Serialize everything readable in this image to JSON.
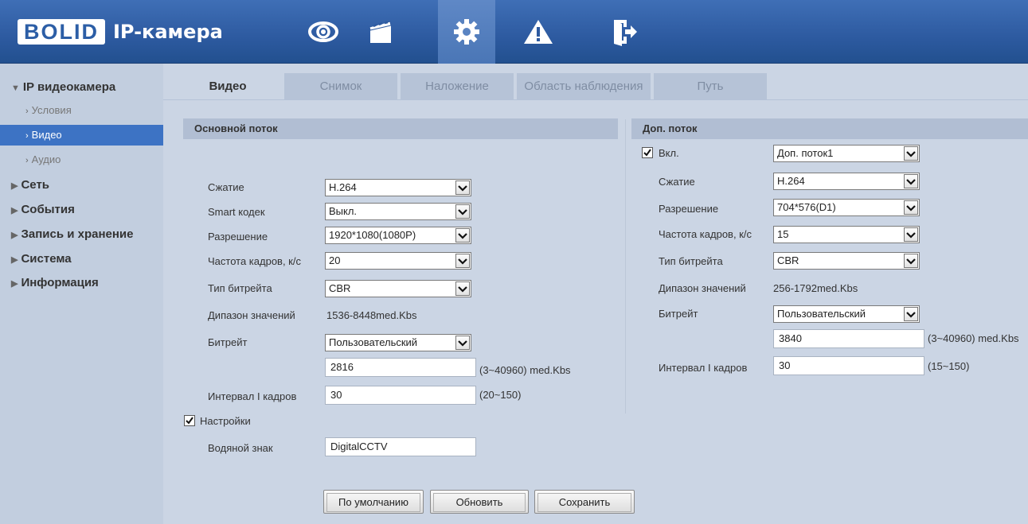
{
  "app": {
    "logo": "BOLID",
    "title": "IP-камера"
  },
  "topnav": [
    {
      "icon": "eye-icon"
    },
    {
      "icon": "clapperboard-icon"
    },
    {
      "icon": "gear-icon"
    },
    {
      "icon": "warning-icon"
    },
    {
      "icon": "logout-icon"
    }
  ],
  "sidebar": {
    "ipcam": "IP видеокамера",
    "conditions": "Условия",
    "video": "Видео",
    "audio": "Аудио",
    "network": "Сеть",
    "events": "События",
    "storage": "Запись и хранение",
    "system": "Система",
    "info": "Информация"
  },
  "tabs": [
    "Видео",
    "Снимок",
    "Наложение",
    "Область наблюдения",
    "Путь"
  ],
  "main_stream": {
    "title": "Основной поток",
    "compression_label": "Сжатие",
    "compression": "H.264",
    "smart_label": "Smart кодек",
    "smart": "Выкл.",
    "resolution_label": "Разрешение",
    "resolution": "1920*1080(1080P)",
    "fps_label": "Частота кадров, к/с",
    "fps": "20",
    "bitrate_type_label": "Тип битрейта",
    "bitrate_type": "CBR",
    "range_label": "Дипазон значений",
    "range": "1536-8448med.Kbs",
    "bitrate_label": "Битрейт",
    "bitrate_mode": "Пользовательский",
    "bitrate_value": "2816",
    "bitrate_hint": "(3~40960) med.Kbs",
    "iframe_label": "Интервал I кадров",
    "iframe": "30",
    "iframe_hint": "(20~150)",
    "settings_label": "Настройки",
    "watermark_label": "Водяной знак",
    "watermark": "DigitalCCTV"
  },
  "sub_stream": {
    "title": "Доп. поток",
    "enable_label": "Вкл.",
    "stream": "Доп. поток1",
    "compression_label": "Сжатие",
    "compression": "H.264",
    "resolution_label": "Разрешение",
    "resolution": "704*576(D1)",
    "fps_label": "Частота кадров, к/с",
    "fps": "15",
    "bitrate_type_label": "Тип битрейта",
    "bitrate_type": "CBR",
    "range_label": "Дипазон значений",
    "range": "256-1792med.Kbs",
    "bitrate_label": "Битрейт",
    "bitrate_mode": "Пользовательский",
    "bitrate_value": "3840",
    "bitrate_hint": "(3~40960) med.Kbs",
    "iframe_label": "Интервал I кадров",
    "iframe": "30",
    "iframe_hint": "(15~150)"
  },
  "buttons": {
    "default": "По умолчанию",
    "refresh": "Обновить",
    "save": "Сохранить"
  }
}
